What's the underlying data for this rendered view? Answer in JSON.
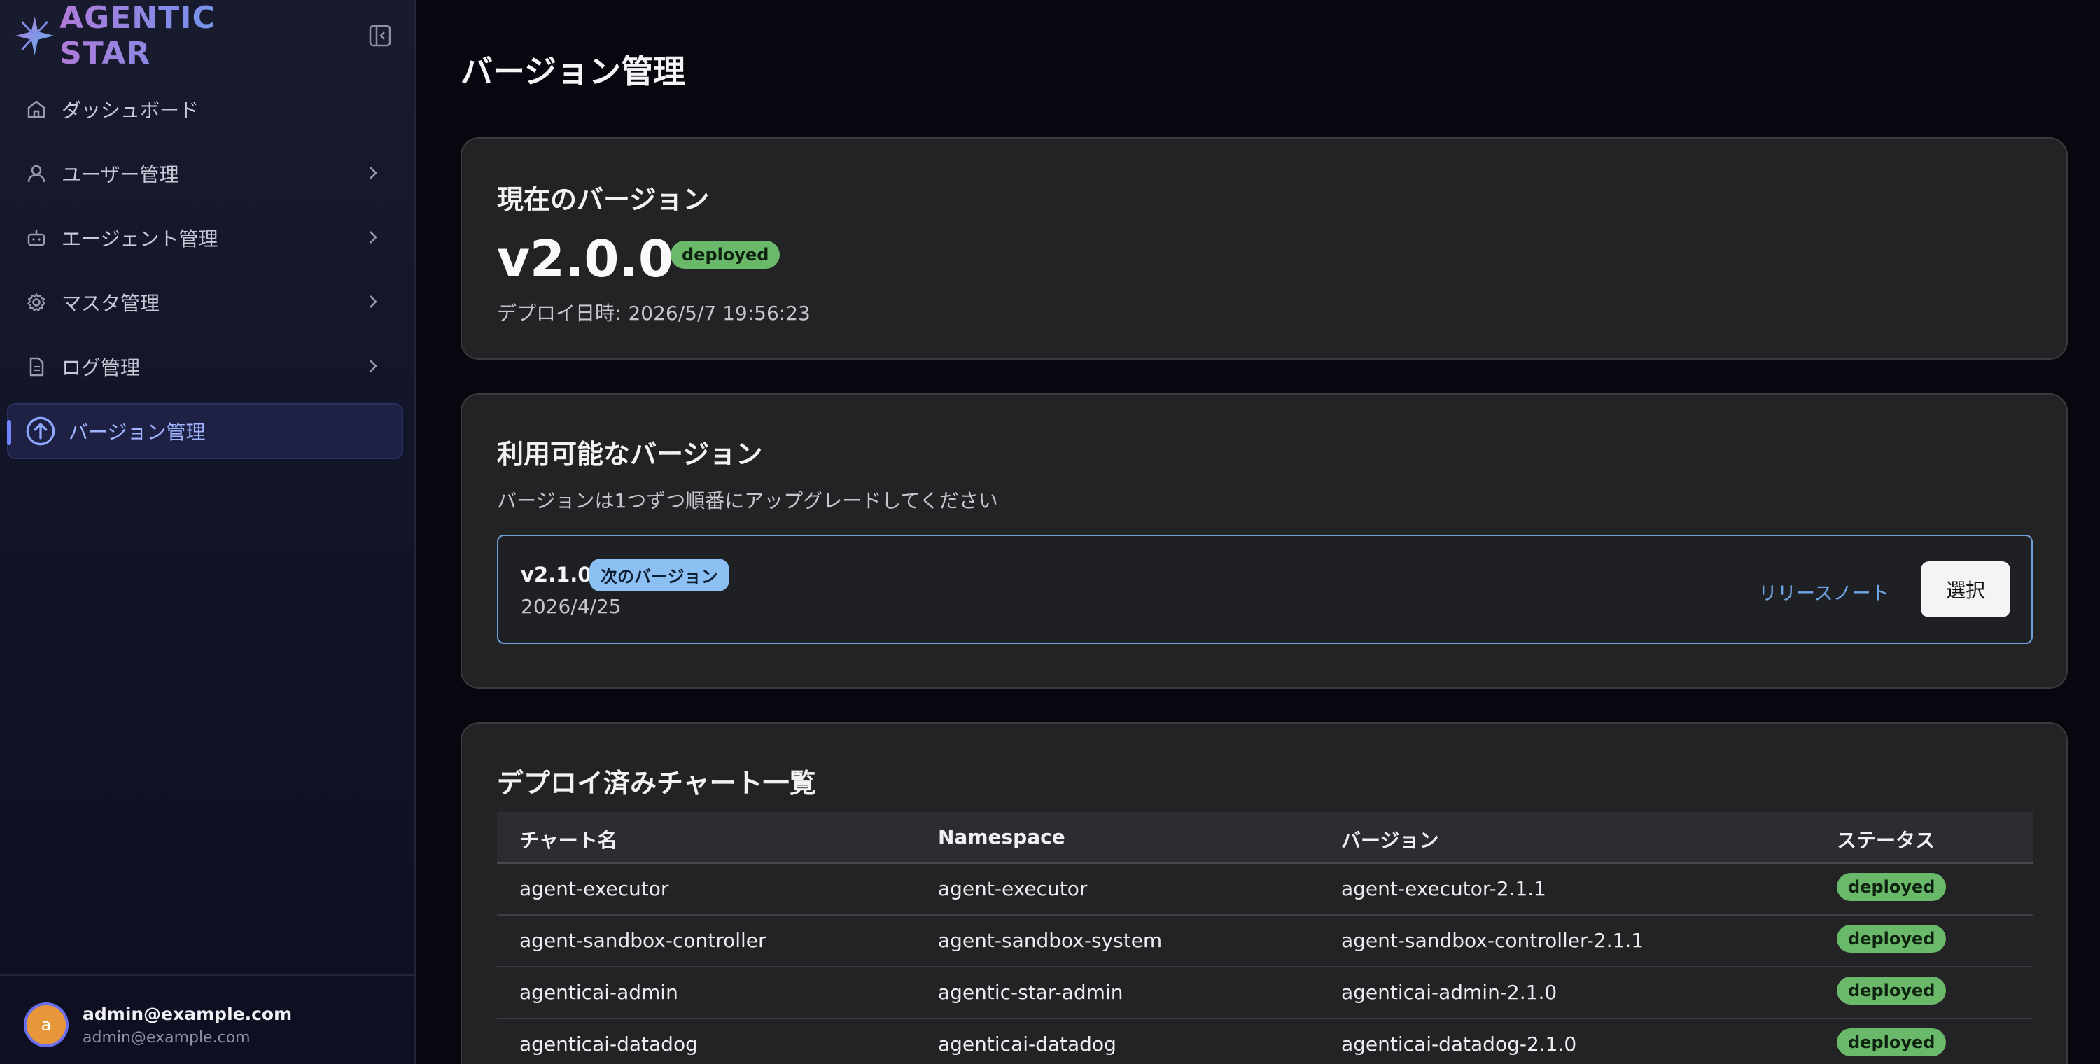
{
  "brand": {
    "name": "AGENTIC STAR"
  },
  "sidebar": {
    "items": [
      {
        "label": "ダッシュボード",
        "icon": "home-icon"
      },
      {
        "label": "ユーザー管理",
        "icon": "user-icon"
      },
      {
        "label": "エージェント管理",
        "icon": "bot-icon"
      },
      {
        "label": "マスタ管理",
        "icon": "gear-icon"
      },
      {
        "label": "ログ管理",
        "icon": "document-icon"
      },
      {
        "label": "バージョン管理",
        "icon": "upgrade-arrow-icon"
      }
    ]
  },
  "user": {
    "initial": "a",
    "name": "admin@example.com",
    "email": "admin@example.com"
  },
  "page": {
    "title": "バージョン管理"
  },
  "current": {
    "title": "現在のバージョン",
    "version": "v2.0.0",
    "status": "deployed",
    "deploy_label": "デプロイ日時:",
    "deploy_date": "2026/5/7 19:56:23"
  },
  "available": {
    "title": "利用可能なバージョン",
    "subtitle": "バージョンは1つずつ順番にアップグレードしてください",
    "items": [
      {
        "version": "v2.1.0",
        "badge": "次のバージョン",
        "date": "2026/4/25",
        "release_notes": "リリースノート",
        "select": "選択"
      }
    ]
  },
  "charts": {
    "title": "デプロイ済みチャート一覧",
    "columns": [
      "チャート名",
      "Namespace",
      "バージョン",
      "ステータス"
    ],
    "rows": [
      {
        "name": "agent-executor",
        "namespace": "agent-executor",
        "version": "agent-executor-2.1.1",
        "status": "deployed"
      },
      {
        "name": "agent-sandbox-controller",
        "namespace": "agent-sandbox-system",
        "version": "agent-sandbox-controller-2.1.1",
        "status": "deployed"
      },
      {
        "name": "agenticai-admin",
        "namespace": "agentic-star-admin",
        "version": "agenticai-admin-2.1.0",
        "status": "deployed"
      },
      {
        "name": "agenticai-datadog",
        "namespace": "agenticai-datadog",
        "version": "agenticai-datadog-2.1.0",
        "status": "deployed"
      }
    ]
  },
  "colors": {
    "accent": "#6f86ff",
    "success": "#6ab86a",
    "info": "#8cc0f2",
    "link": "#6fa8e8"
  }
}
